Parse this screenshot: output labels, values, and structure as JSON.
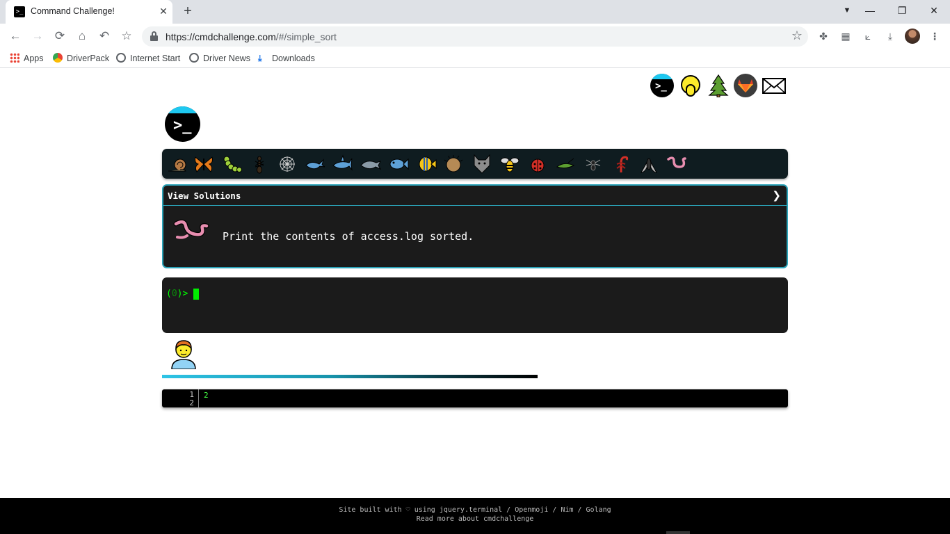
{
  "browser": {
    "tab_title": "Command Challenge!",
    "tab_close": "✕",
    "new_tab": "+",
    "url_host": "https://cmdchallenge.com",
    "url_path": "/#/simple_sort",
    "window_controls": {
      "minimize": "—",
      "maximize": "❐",
      "close": "✕"
    },
    "nav": {
      "back": "←",
      "forward": "→",
      "reload": "⟳",
      "home": "⌂",
      "undo": "↶",
      "bookmark": "☆"
    },
    "bookmarks": [
      {
        "label": "Apps",
        "icon": "apps-grid-icon"
      },
      {
        "label": "DriverPack",
        "icon": "driverpack-icon"
      },
      {
        "label": "Internet Start",
        "icon": "globe-icon"
      },
      {
        "label": "Driver News",
        "icon": "globe-icon"
      },
      {
        "label": "Downloads",
        "icon": "download-icon"
      }
    ],
    "accent_color": "#1a73e8"
  },
  "page": {
    "social_links": [
      {
        "name": "cmdchallenge",
        "icon": "terminal-icon"
      },
      {
        "name": "oops",
        "icon": "face-with-hand-over-mouth-icon"
      },
      {
        "name": "tree",
        "icon": "evergreen-tree-icon"
      },
      {
        "name": "gitlab",
        "icon": "gitlab-icon"
      },
      {
        "name": "email",
        "icon": "envelope-icon"
      }
    ],
    "logo_glyph": ">_",
    "levels": [
      "snail",
      "butterfly",
      "caterpillar",
      "ant",
      "spider-web",
      "whale",
      "shark",
      "dolphin",
      "fish",
      "tropical-fish",
      "blowfish",
      "wolf",
      "bee",
      "ladybug",
      "cricket",
      "spider",
      "scorpion",
      "fly",
      "worm"
    ],
    "challenge": {
      "header": "View Solutions",
      "chevron": "❯",
      "description": "Print the contents of access.log sorted."
    },
    "terminal": {
      "prompt_open": "(",
      "prompt_num": "0",
      "prompt_close": ")>"
    },
    "editor": {
      "line_numbers": [
        "1",
        "2"
      ],
      "code": "2"
    },
    "footer": {
      "line1": "Site built with ♡ using jquery.terminal / Openmoji / Nim / Golang",
      "line2": "Read more about cmdchallenge"
    },
    "colors": {
      "challenge_border": "#2ba3b8",
      "terminal_green": "#00ff00",
      "level_bar": "#0f1c20"
    }
  }
}
